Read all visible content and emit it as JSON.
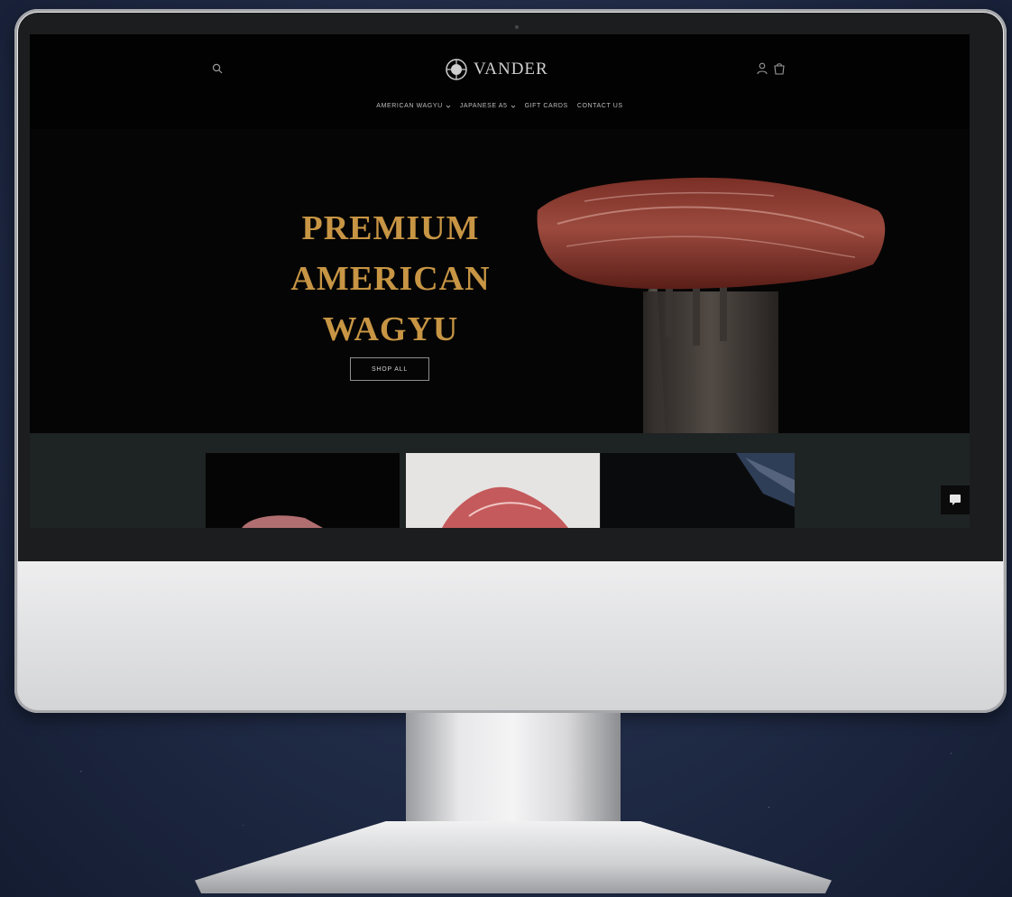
{
  "site": {
    "logo_text": "VANDER",
    "nav": {
      "items": [
        {
          "label": "AMERICAN WAGYU"
        },
        {
          "label": "JAPANESE A5"
        },
        {
          "label": "GIFT CARDS"
        },
        {
          "label": "CONTACT US"
        }
      ]
    },
    "hero": {
      "title_lines": [
        "PREMIUM",
        "AMERICAN",
        "WAGYU"
      ],
      "button_label": "SHOP ALL"
    }
  },
  "colors": {
    "hero_title": "#c79544",
    "background": "#050505",
    "strip": "#1e2423"
  },
  "icons": [
    "search-icon",
    "logo-emblem-icon",
    "account-icon",
    "cart-icon",
    "chevron-down-icon",
    "chat-icon"
  ]
}
